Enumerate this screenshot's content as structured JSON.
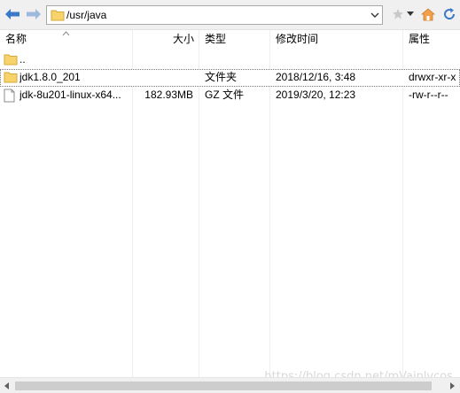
{
  "toolbar": {
    "path": "/usr/java",
    "back_icon": "back-arrow-icon",
    "forward_icon": "forward-arrow-icon"
  },
  "columns": {
    "name": "名称",
    "size": "大小",
    "type": "类型",
    "modified": "修改时间",
    "attributes": "属性"
  },
  "rows": [
    {
      "name": "..",
      "size": "",
      "type": "",
      "modified": "",
      "attributes": "",
      "icon": "folder"
    },
    {
      "name": "jdk1.8.0_201",
      "size": "",
      "type": "文件夹",
      "modified": "2018/12/16, 3:48",
      "attributes": "drwxr-xr-x",
      "icon": "folder"
    },
    {
      "name": "jdk-8u201-linux-x64...",
      "size": "182.93MB",
      "type": "GZ 文件",
      "modified": "2019/3/20, 12:23",
      "attributes": "-rw-r--r--",
      "icon": "file"
    }
  ],
  "watermark": "https://blog.csdn.net/mVainlycos"
}
